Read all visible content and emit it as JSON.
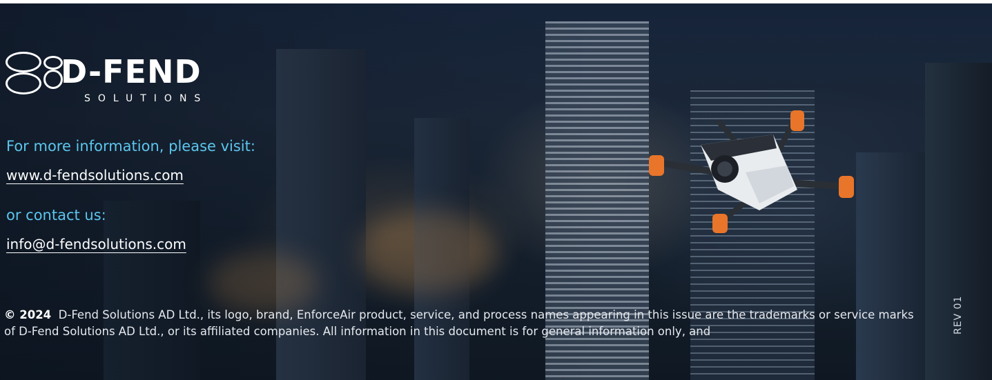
{
  "logo": {
    "name": "D-FEND",
    "subtitle": "SOLUTIONS"
  },
  "contact": {
    "visit_prompt": "For more information, please visit:",
    "website": "www.d-fendsolutions.com",
    "contact_prompt": "or contact us:",
    "email": "info@d-fendsolutions.com"
  },
  "legal": {
    "copyright_year": "© 2024",
    "text": "D-Fend Solutions AD Ltd., its logo, brand, EnforceAir product, service, and process names appearing in this issue are the trademarks or service marks of D-Fend Solutions AD Ltd., or its affiliated companies. All information in this document is for general information only, and"
  },
  "revision": "REV 01",
  "colors": {
    "accent_text": "#5cc6ee",
    "primary_text": "#ffffff"
  },
  "icons": {
    "logo_mark": "dfend-logo-icon",
    "drone": "drone-icon"
  }
}
